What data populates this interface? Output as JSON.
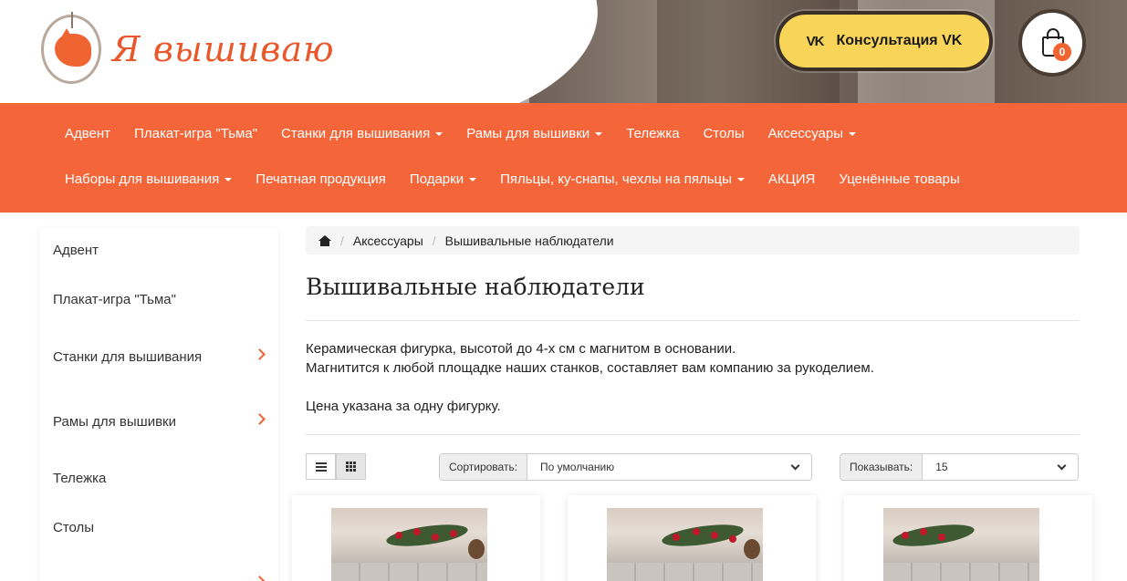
{
  "header": {
    "logo_text": "Я вышиваю",
    "vk_button": {
      "icon": "vk-icon",
      "icon_text": "VK",
      "label": "Консультация VK"
    },
    "cart": {
      "icon": "shopping-bag-icon",
      "count": "0"
    }
  },
  "nav": {
    "row1": [
      {
        "label": "Адвент",
        "dropdown": false
      },
      {
        "label": "Плакат-игра \"Тьма\"",
        "dropdown": false
      },
      {
        "label": "Станки для вышивания",
        "dropdown": true
      },
      {
        "label": "Рамы для вышивки",
        "dropdown": true
      },
      {
        "label": "Тележка",
        "dropdown": false
      },
      {
        "label": "Столы",
        "dropdown": false
      },
      {
        "label": "Аксессуары",
        "dropdown": true
      }
    ],
    "row2": [
      {
        "label": "Наборы для вышивания",
        "dropdown": true
      },
      {
        "label": "Печатная продукция",
        "dropdown": false
      },
      {
        "label": "Подарки",
        "dropdown": true
      },
      {
        "label": "Пяльцы, ку-снапы, чехлы на пяльцы",
        "dropdown": true
      },
      {
        "label": "АКЦИЯ",
        "dropdown": false
      },
      {
        "label": "Уценённые товары",
        "dropdown": false
      }
    ]
  },
  "sidebar": {
    "items": [
      {
        "label": "Адвент",
        "has_children": false
      },
      {
        "label": "Плакат-игра \"Тьма\"",
        "has_children": false
      },
      {
        "label": "Станки для вышивания",
        "has_children": true
      },
      {
        "label": "Рамы для вышивки",
        "has_children": true
      },
      {
        "label": "Тележка",
        "has_children": false
      },
      {
        "label": "Столы",
        "has_children": false
      }
    ]
  },
  "breadcrumb": {
    "home_icon": "home-icon",
    "items": [
      "Аксессуары",
      "Вышивальные наблюдатели"
    ]
  },
  "page": {
    "title": "Вышивальные наблюдатели",
    "description": [
      "Керамическая фигурка, высотой до 4-х см с магнитом в основании.",
      "Магнитится к любой площадке наших станков, составляет вам компанию за рукоделием.",
      "",
      "Цена указана за одну фигурку."
    ]
  },
  "toolbar": {
    "view_list_icon": "list-icon",
    "view_grid_icon": "grid-icon",
    "active_view": "grid",
    "sort_label": "Сортировать:",
    "sort_value": "По умолчанию",
    "limit_label": "Показывать:",
    "limit_value": "15"
  },
  "colors": {
    "accent": "#f4663a",
    "vk_button": "#f8d558",
    "badge": "#f06432"
  }
}
